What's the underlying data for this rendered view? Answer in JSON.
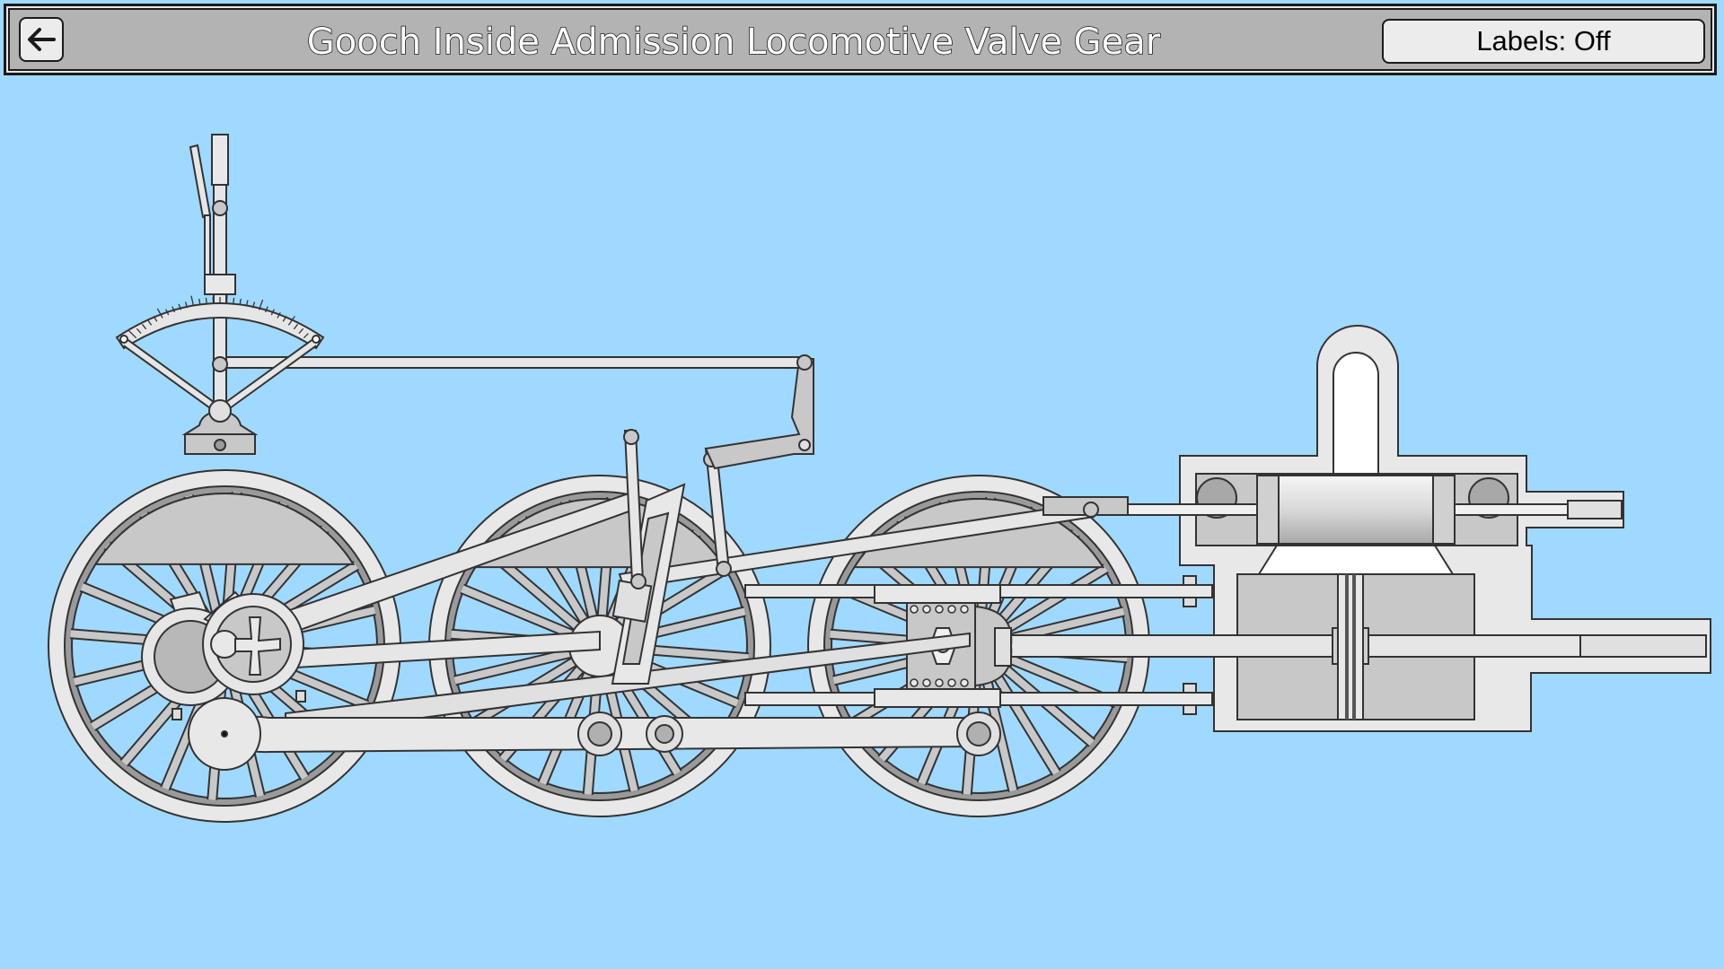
{
  "window": {
    "title": "Gooch Inside Admission Locomotive Valve Gear"
  },
  "toolbar": {
    "back_icon": "arrow-left-icon",
    "labels_button": "Labels: Off"
  },
  "colors": {
    "background": "#a0d9ff",
    "header": "#b3b3b3",
    "button": "#ececec",
    "metal_light": "#e6e6e6",
    "metal_mid": "#c8c8c8",
    "metal_dark": "#9a9a9a",
    "outline": "#333333"
  },
  "mechanism": {
    "wheel_count": 3,
    "spokes_per_wheel": 20,
    "reverser_scale_ticks": 29
  }
}
